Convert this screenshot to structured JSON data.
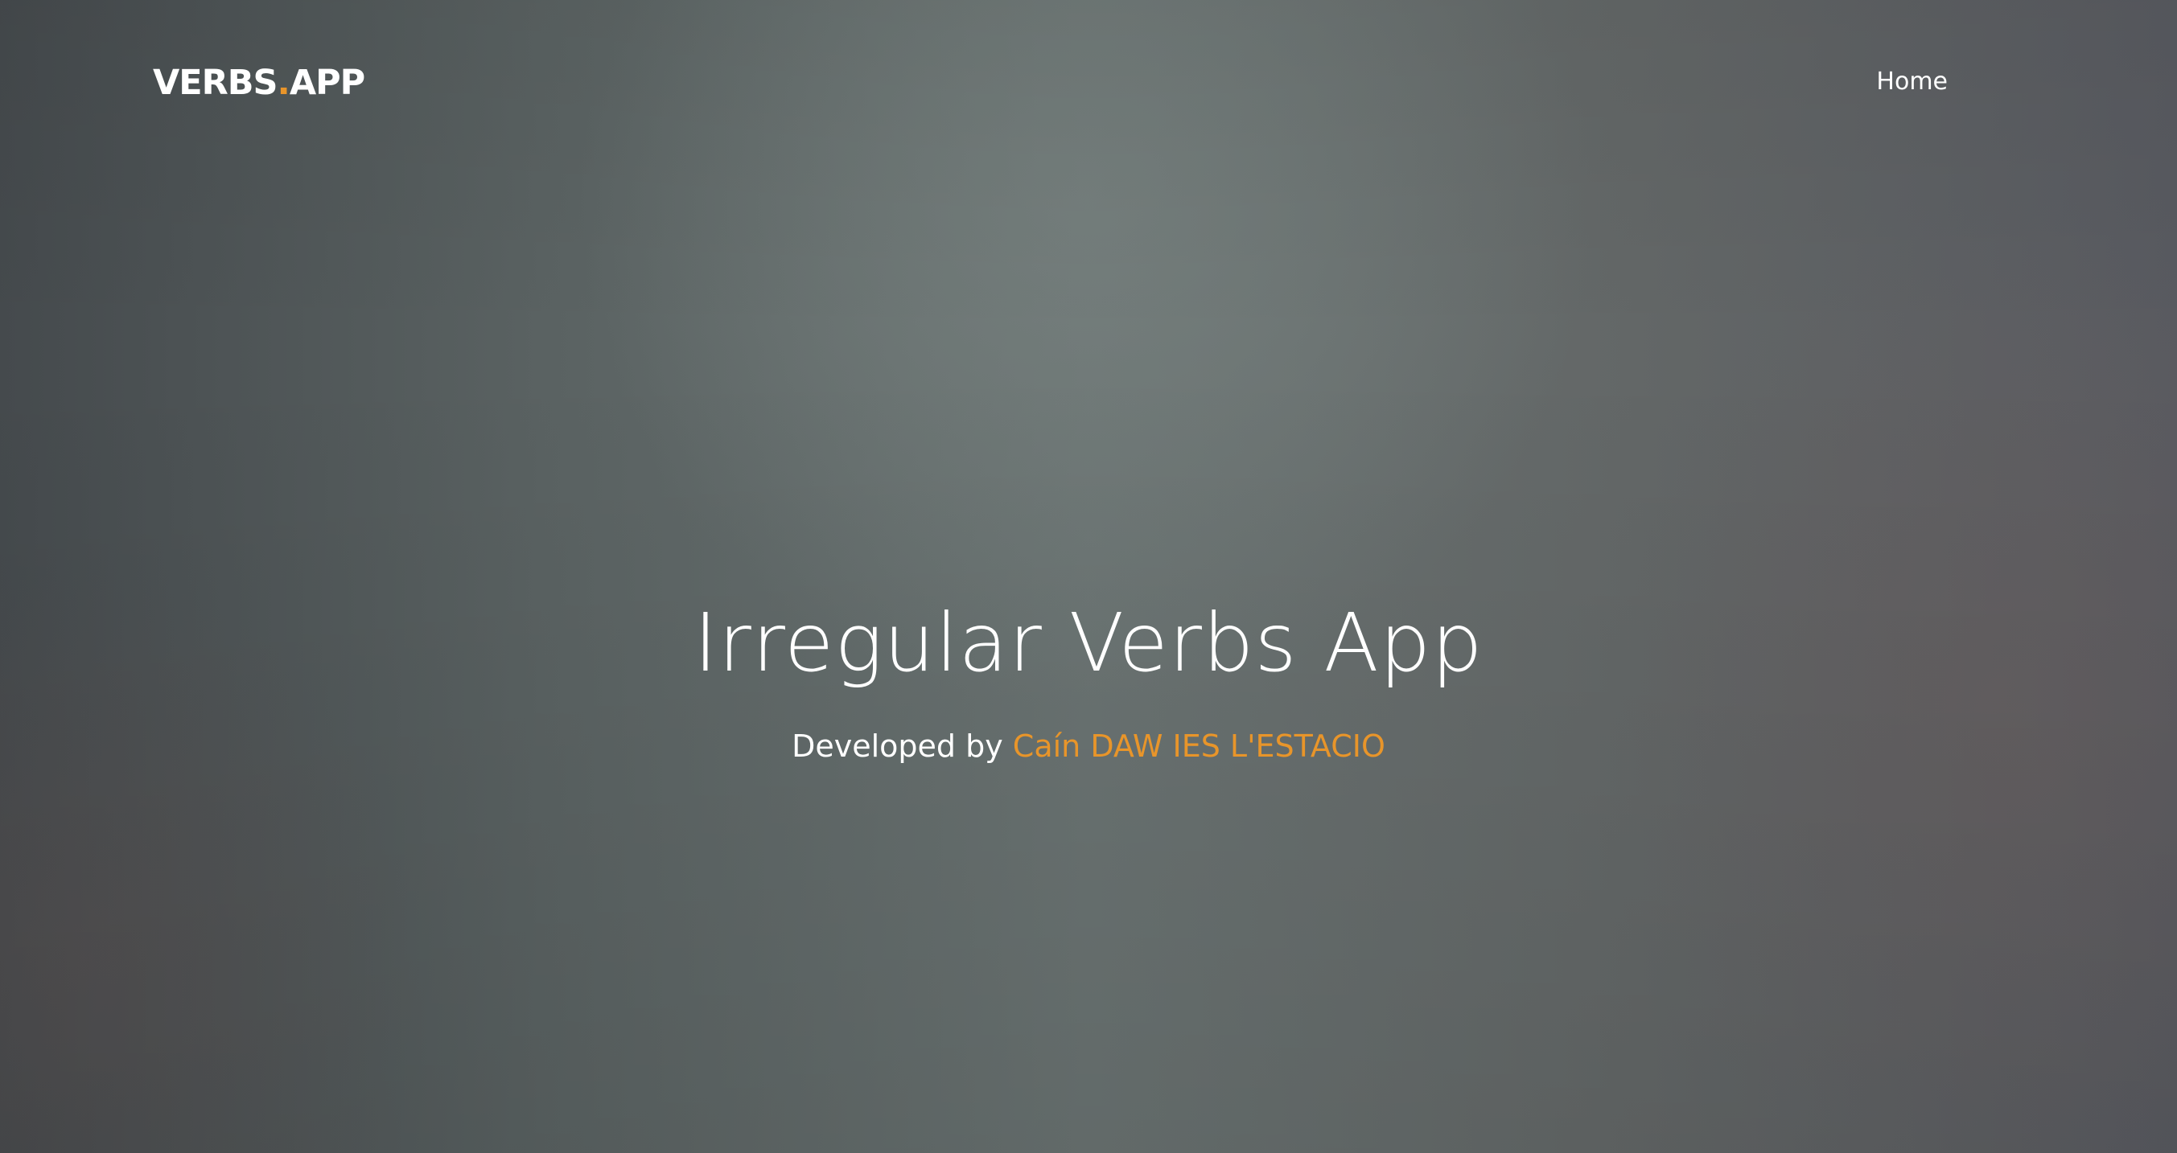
{
  "navbar": {
    "brand_prefix": "VERBS",
    "brand_dot": ".",
    "brand_suffix": "APP",
    "links": [
      {
        "label": "Home"
      }
    ]
  },
  "hero": {
    "title": "Irregular Verbs App",
    "subtitle_prefix": "Developed by",
    "author": "Caín DAW IES L'ESTACIO"
  },
  "colors": {
    "accent": "#e8952a",
    "text": "#ffffff",
    "background": "#5f6666"
  }
}
